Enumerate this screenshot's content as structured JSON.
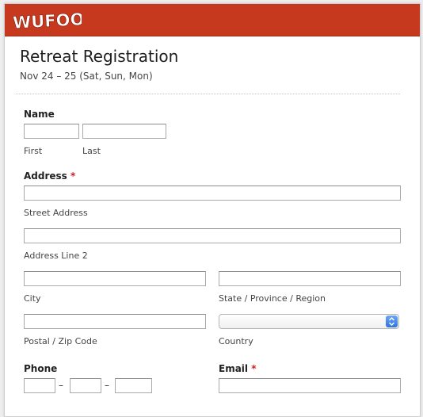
{
  "brand": {
    "logo_text": "WUFOO",
    "header_color": "#c6391f"
  },
  "form": {
    "title": "Retreat Registration",
    "subtitle": "Nov 24 – 25 (Sat, Sun, Mon)"
  },
  "name": {
    "label": "Name",
    "first_label": "First",
    "last_label": "Last",
    "first_value": "",
    "last_value": ""
  },
  "address": {
    "label": "Address",
    "required_mark": "*",
    "street_label": "Street Address",
    "line2_label": "Address Line 2",
    "city_label": "City",
    "state_label": "State / Province / Region",
    "postal_label": "Postal / Zip Code",
    "country_label": "Country",
    "country_value": ""
  },
  "phone": {
    "label": "Phone",
    "separator": "–"
  },
  "email": {
    "label": "Email",
    "required_mark": "*"
  }
}
